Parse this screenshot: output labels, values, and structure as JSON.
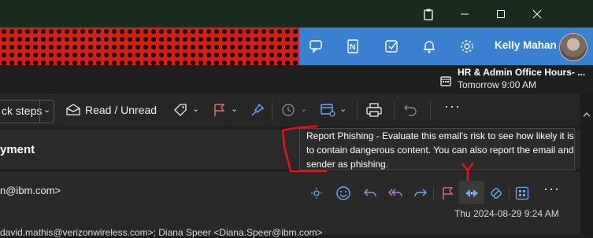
{
  "user": {
    "name": "Kelly Mahan"
  },
  "reminder": {
    "title": "HR & Admin Office Hours- ...",
    "time": "Tomorrow 9:00 AM"
  },
  "ribbon": {
    "quick_steps": "ck steps",
    "read_unread": "Read / Unread"
  },
  "message": {
    "subject": "yment",
    "sender": "n@ibm.com>",
    "date": "Thu 2024-08-29 9:24 AM",
    "recipients": "david.mathis@verizonwireless.com>;  Diana Speer <Diana.Speer@ibm.com>"
  },
  "tooltip": {
    "text": "Report Phishing - Evaluate this email's risk to see how likely it is to contain dangerous content. You can also report the email and sender as phishing."
  },
  "colors": {
    "accent": "#3a7fd0",
    "annotation": "#e5141a",
    "icon_blue": "#6ea8ff"
  }
}
